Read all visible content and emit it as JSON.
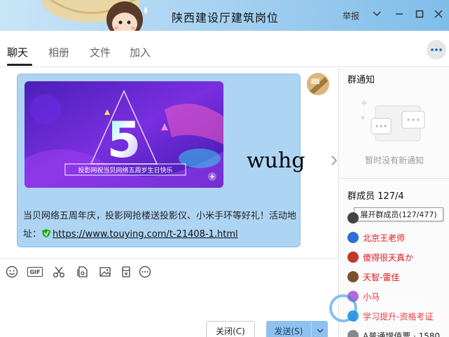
{
  "window": {
    "title": "陕西建设厅建筑岗位",
    "report_label": "举报"
  },
  "tabs": [
    {
      "label": "聊天",
      "active": true
    },
    {
      "label": "相册",
      "active": false
    },
    {
      "label": "文件",
      "active": false
    },
    {
      "label": "加入",
      "active": false
    }
  ],
  "message": {
    "banner_caption": "投影网祝当贝网络五周岁生日快乐",
    "text_line1": "当贝网络五周年庆，投影网抢楼送投影仪、小米手环等好礼！活动地",
    "text_prefix": "址：",
    "link": "https://www.touying.com/t-21408-1.html",
    "overlay_text": "wuhg"
  },
  "toolbar": {
    "icons": [
      "smiley-icon",
      "gif-icon",
      "scissors-icon",
      "file-icon",
      "image-icon",
      "red-packet-icon",
      "more-icon"
    ],
    "gif_label": "GIF"
  },
  "buttons": {
    "close_label": "关闭(C)",
    "send_label": "发送(S)"
  },
  "right_panel": {
    "notice_title": "群通知",
    "notice_empty": "暂时没有新通知",
    "members_title": "群成员",
    "members_count": "127/4",
    "tooltip": "展开群成员(127/477)",
    "members": [
      {
        "name": "北京王老师",
        "color": "red"
      },
      {
        "name": "傻得很天真か",
        "color": "red"
      },
      {
        "name": "天智-雷佳",
        "color": "red"
      },
      {
        "name": "小马",
        "color": "red"
      },
      {
        "name": "学习提升-资格考证",
        "color": "red"
      },
      {
        "name": "A普通增值票 · 1580",
        "color": "dark"
      }
    ]
  },
  "colors": {
    "bubble": "#aed4f3",
    "send_button": "#8fc1ee",
    "member_red": "#e0161e"
  }
}
